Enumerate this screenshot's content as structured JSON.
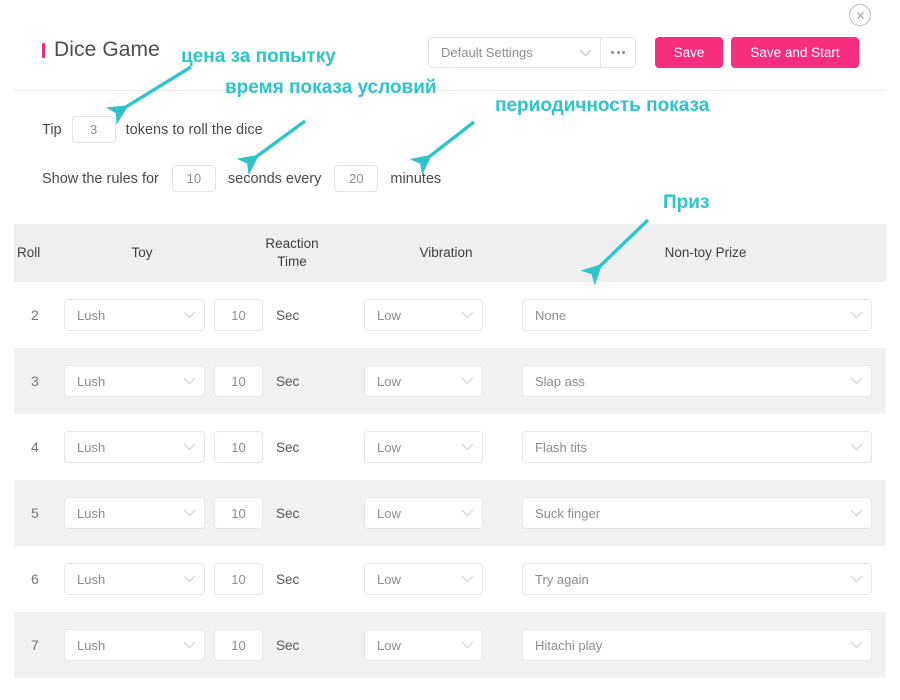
{
  "window": {
    "close_icon": "close-circle-icon"
  },
  "header": {
    "title": "Dice Game",
    "settings_select": {
      "value": "Default Settings",
      "chevron_icon": "chevron-down-icon"
    },
    "more_button": {
      "label": "•••",
      "icon": "ellipsis-icon"
    },
    "save_label": "Save",
    "save_and_start_label": "Save and Start",
    "accent_color": "#f72d7f"
  },
  "settings": {
    "tip": {
      "prefix": "Tip",
      "value": "3",
      "suffix": "tokens to roll the dice"
    },
    "rules": {
      "prefix": "Show the rules for",
      "seconds_value": "10",
      "middle": "seconds every",
      "minutes_value": "20",
      "suffix": "minutes"
    }
  },
  "table": {
    "headers": {
      "roll": "Roll",
      "toy": "Toy",
      "reaction_time_line1": "Reaction",
      "reaction_time_line2": "Time",
      "vibration": "Vibration",
      "non_toy_prize": "Non-toy Prize"
    },
    "unit_label": "Sec",
    "rows": [
      {
        "roll": "2",
        "toy": "Lush",
        "reaction_time": "10",
        "unit": "Sec",
        "vibration": "Low",
        "prize": "None"
      },
      {
        "roll": "3",
        "toy": "Lush",
        "reaction_time": "10",
        "unit": "Sec",
        "vibration": "Low",
        "prize": "Slap ass"
      },
      {
        "roll": "4",
        "toy": "Lush",
        "reaction_time": "10",
        "unit": "Sec",
        "vibration": "Low",
        "prize": "Flash tits"
      },
      {
        "roll": "5",
        "toy": "Lush",
        "reaction_time": "10",
        "unit": "Sec",
        "vibration": "Low",
        "prize": "Suck finger"
      },
      {
        "roll": "6",
        "toy": "Lush",
        "reaction_time": "10",
        "unit": "Sec",
        "vibration": "Low",
        "prize": "Try again"
      },
      {
        "roll": "7",
        "toy": "Lush",
        "reaction_time": "10",
        "unit": "Sec",
        "vibration": "Low",
        "prize": "Hitachi play"
      }
    ]
  },
  "annotations": {
    "color": "#2ec4cb",
    "items": [
      {
        "text": "цена за попытку"
      },
      {
        "text": "время показа условий"
      },
      {
        "text": "периодичность показа"
      },
      {
        "text": "Приз"
      }
    ]
  }
}
